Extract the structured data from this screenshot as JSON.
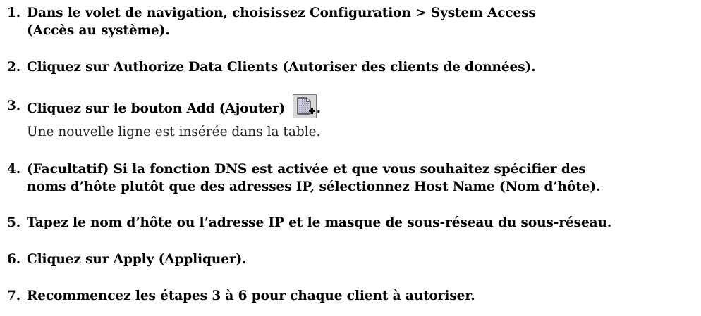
{
  "steps": [
    {
      "number": "1.",
      "text": "Dans le volet de navigation, choisissez Configuration > System Access",
      "text2": "(Accès au système)."
    },
    {
      "number": "2.",
      "text": "Cliquez sur Authorize Data Clients (Autoriser des clients de données)."
    },
    {
      "number": "3.",
      "text": "Cliquez sur le bouton Add (Ajouter)",
      "suffix": ".",
      "icon": "add-row-icon",
      "note": "Une nouvelle ligne est insérée dans la table."
    },
    {
      "number": "4.",
      "text": "(Facultatif) Si la fonction DNS est activée et que vous souhaitez spécifier des",
      "text2": "noms d’hôte plutôt que des adresses IP, sélectionnez Host Name (Nom d’hôte)."
    },
    {
      "number": "5.",
      "text": "Tapez le nom d’hôte ou l’adresse IP et le masque de sous-réseau du sous-réseau."
    },
    {
      "number": "6.",
      "text": "Cliquez sur Apply (Appliquer)."
    },
    {
      "number": "7.",
      "text": "Recommencez les étapes 3 à 6 pour chaque client à autoriser."
    }
  ]
}
